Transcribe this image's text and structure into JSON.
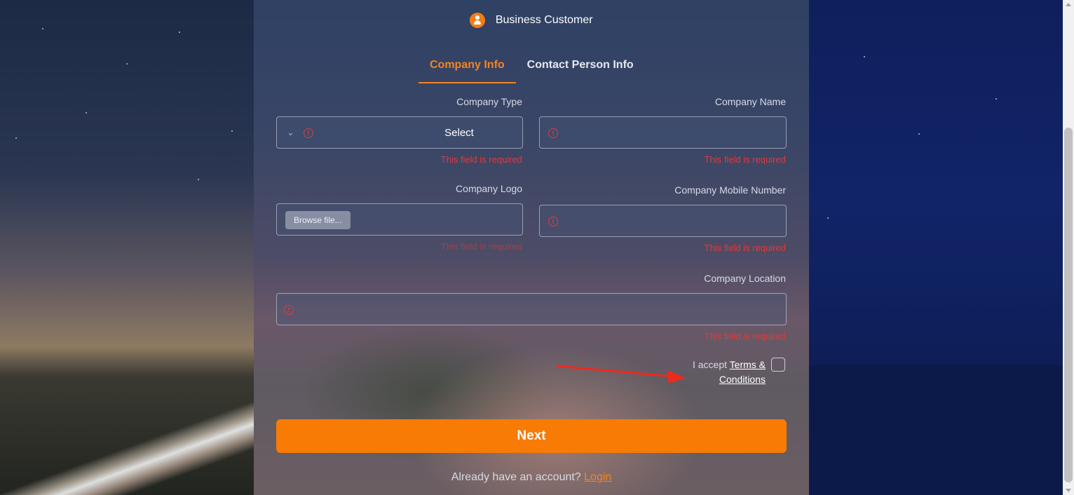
{
  "header": {
    "icon": "business-user-icon",
    "title": "Business Customer"
  },
  "tabs": [
    {
      "label": "Company Info",
      "active": true
    },
    {
      "label": "Contact Person Info",
      "active": false
    }
  ],
  "form": {
    "company_type": {
      "label": "Company Type",
      "value": "Select",
      "error": "This field is required"
    },
    "company_name": {
      "label": "Company Name",
      "value": "",
      "error": "This field is required"
    },
    "company_logo": {
      "label": "Company Logo",
      "button": "Browse file...",
      "error": "This field is required"
    },
    "company_mobile": {
      "label": "Company Mobile Number",
      "value": "",
      "error": "This field is required"
    },
    "company_location": {
      "label": "Company Location",
      "value": "",
      "error": "This field is required"
    }
  },
  "terms": {
    "prefix": "I accept",
    "link": "Terms & Conditions",
    "checked": false
  },
  "next_label": "Next",
  "login": {
    "prompt": "Already have an account?",
    "link": "Login"
  },
  "colors": {
    "accent": "#f77b04",
    "error": "#e03a3a"
  }
}
